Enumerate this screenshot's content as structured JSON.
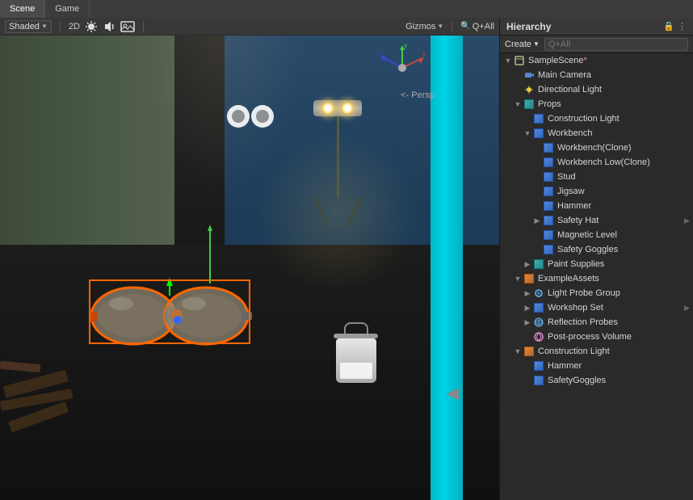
{
  "tabs": {
    "scene_label": "Scene",
    "game_label": "Game"
  },
  "scene_toolbar": {
    "shading_label": "Shaded",
    "mode_2d": "2D",
    "gizmos_label": "Gizmos",
    "search_all": "All",
    "q_all": "Q+All"
  },
  "viewport": {
    "persp_label": "<- Persp"
  },
  "hierarchy": {
    "title": "Hierarchy",
    "create_label": "Create",
    "search_placeholder": "Q+All",
    "items": [
      {
        "id": "samplescene",
        "label": "SampleScene*",
        "level": 0,
        "arrow": "open",
        "icon": "scene",
        "selected": false
      },
      {
        "id": "maincamera",
        "label": "Main Camera",
        "level": 1,
        "arrow": "empty",
        "icon": "camera",
        "selected": false
      },
      {
        "id": "dirlight",
        "label": "Directional Light",
        "level": 1,
        "arrow": "empty",
        "icon": "light",
        "selected": false
      },
      {
        "id": "props",
        "label": "Props",
        "level": 1,
        "arrow": "open",
        "icon": "group",
        "selected": false
      },
      {
        "id": "constlight1",
        "label": "Construction Light",
        "level": 2,
        "arrow": "empty",
        "icon": "prefab-blue",
        "selected": false
      },
      {
        "id": "workbench",
        "label": "Workbench",
        "level": 2,
        "arrow": "open",
        "icon": "prefab-blue",
        "selected": false
      },
      {
        "id": "workbench_clone",
        "label": "Workbench(Clone)",
        "level": 3,
        "arrow": "empty",
        "icon": "prefab-blue",
        "selected": false
      },
      {
        "id": "workbench_low_clone",
        "label": "Workbench Low(Clone)",
        "level": 3,
        "arrow": "empty",
        "icon": "prefab-blue",
        "selected": false
      },
      {
        "id": "stud",
        "label": "Stud",
        "level": 3,
        "arrow": "empty",
        "icon": "mesh",
        "selected": false
      },
      {
        "id": "jigsaw",
        "label": "Jigsaw",
        "level": 3,
        "arrow": "empty",
        "icon": "mesh",
        "selected": false
      },
      {
        "id": "hammer",
        "label": "Hammer",
        "level": 3,
        "arrow": "empty",
        "icon": "mesh",
        "selected": false
      },
      {
        "id": "safetyhat",
        "label": "Safety Hat",
        "level": 3,
        "arrow": "closed",
        "icon": "mesh",
        "selected": false,
        "has_chevron": true
      },
      {
        "id": "maglevel",
        "label": "Magnetic Level",
        "level": 3,
        "arrow": "empty",
        "icon": "mesh",
        "selected": false
      },
      {
        "id": "safetygoggles_prop",
        "label": "Safety Goggles",
        "level": 3,
        "arrow": "empty",
        "icon": "mesh",
        "selected": false
      },
      {
        "id": "paint_supplies",
        "label": "Paint Supplies",
        "level": 2,
        "arrow": "closed",
        "icon": "group",
        "selected": false
      },
      {
        "id": "exampleassets",
        "label": "ExampleAssets",
        "level": 1,
        "arrow": "open",
        "icon": "prefab-orange",
        "selected": false
      },
      {
        "id": "lightprobegroup",
        "label": "Light Probe Group",
        "level": 2,
        "arrow": "closed",
        "icon": "probe",
        "selected": false
      },
      {
        "id": "workshopset",
        "label": "Workshop Set",
        "level": 2,
        "arrow": "closed",
        "icon": "prefab-blue",
        "selected": false,
        "has_chevron": true
      },
      {
        "id": "reflprobes",
        "label": "Reflection Probes",
        "level": 2,
        "arrow": "closed",
        "icon": "probe",
        "selected": false
      },
      {
        "id": "postprocess",
        "label": "Post-process Volume",
        "level": 2,
        "arrow": "empty",
        "icon": "postprocess",
        "selected": false
      },
      {
        "id": "constlight2",
        "label": "Construction Light",
        "level": 1,
        "arrow": "open",
        "icon": "prefab-orange",
        "selected": false
      },
      {
        "id": "hammer2",
        "label": "Hammer",
        "level": 2,
        "arrow": "empty",
        "icon": "mesh",
        "selected": false
      },
      {
        "id": "safetygoggles2",
        "label": "SafetyGoggles",
        "level": 2,
        "arrow": "empty",
        "icon": "mesh",
        "selected": false
      }
    ]
  }
}
